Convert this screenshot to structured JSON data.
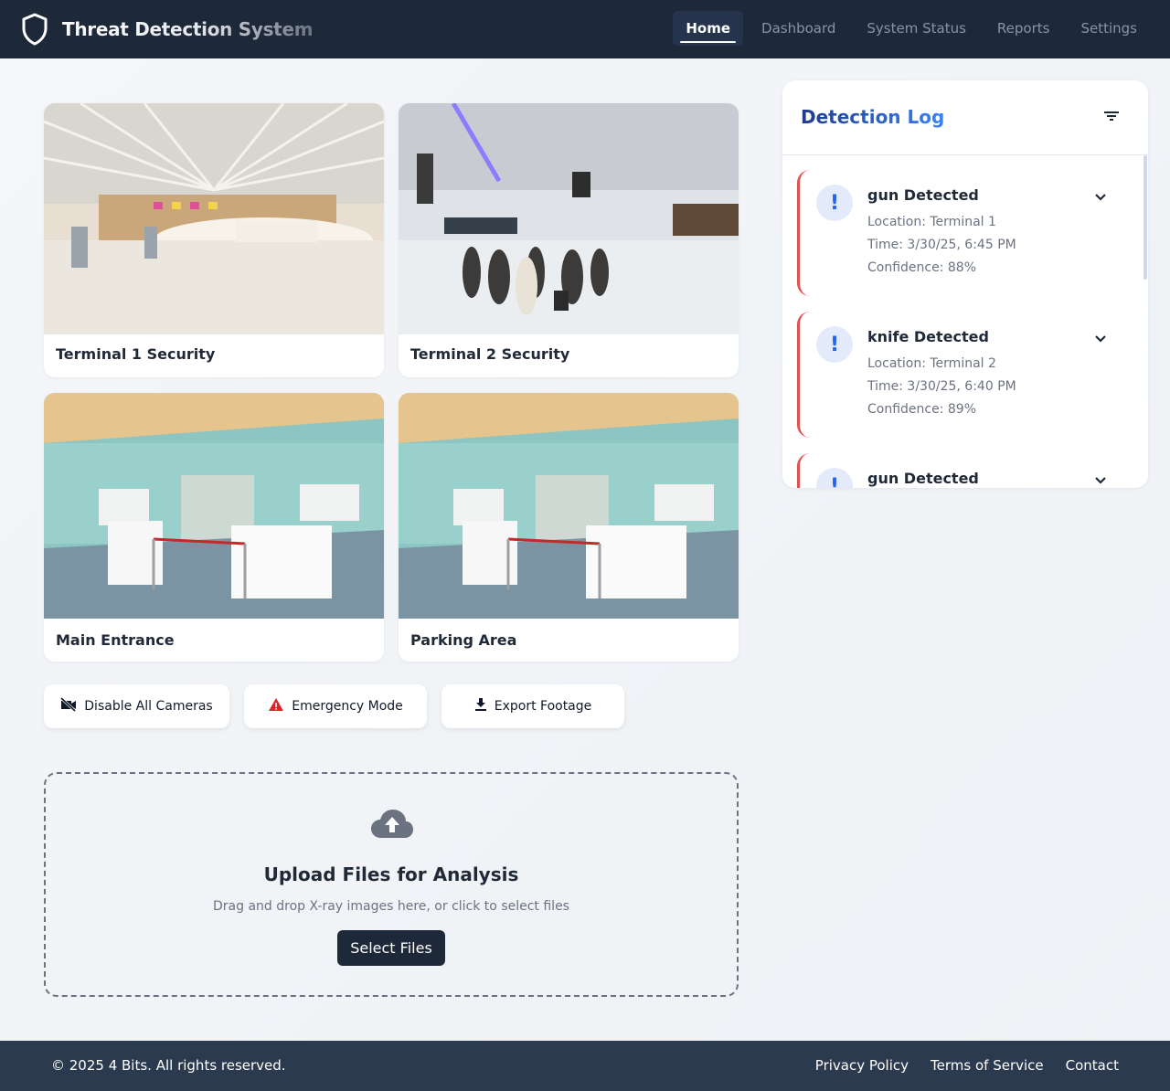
{
  "header": {
    "title": "Threat Detection System",
    "logo_icon": "shield-icon",
    "nav": [
      {
        "label": "Home",
        "active": true
      },
      {
        "label": "Dashboard",
        "active": false
      },
      {
        "label": "System Status",
        "active": false
      },
      {
        "label": "Reports",
        "active": false
      },
      {
        "label": "Settings",
        "active": false
      }
    ]
  },
  "cameras": [
    {
      "label": "Terminal 1 Security"
    },
    {
      "label": "Terminal 2 Security"
    },
    {
      "label": "Main Entrance"
    },
    {
      "label": "Parking Area"
    }
  ],
  "actions": [
    {
      "label": "Disable All Cameras",
      "icon": "camera-off-icon"
    },
    {
      "label": "Emergency Mode",
      "icon": "warning-icon",
      "icon_color": "#dc2626"
    },
    {
      "label": "Export Footage",
      "icon": "download-icon"
    }
  ],
  "upload": {
    "icon": "cloud-upload-icon",
    "title": "Upload Files for Analysis",
    "subtitle": "Drag and drop X-ray images here, or click to select files",
    "button": "Select Files"
  },
  "detection_log": {
    "title": "Detection Log",
    "filter_icon": "filter-icon",
    "items": [
      {
        "title": "gun Detected",
        "location": "Location: Terminal 1",
        "time": "Time: 3/30/25, 6:45 PM",
        "confidence": "Confidence: 88%"
      },
      {
        "title": "knife Detected",
        "location": "Location: Terminal 2",
        "time": "Time: 3/30/25, 6:40 PM",
        "confidence": "Confidence: 89%"
      },
      {
        "title": "gun Detected",
        "location": "",
        "time": "",
        "confidence": ""
      }
    ],
    "accent_color": "#e25050"
  },
  "footer": {
    "copyright": "© 2025 4 Bits. All rights reserved.",
    "links": [
      "Privacy Policy",
      "Terms of Service",
      "Contact"
    ]
  }
}
